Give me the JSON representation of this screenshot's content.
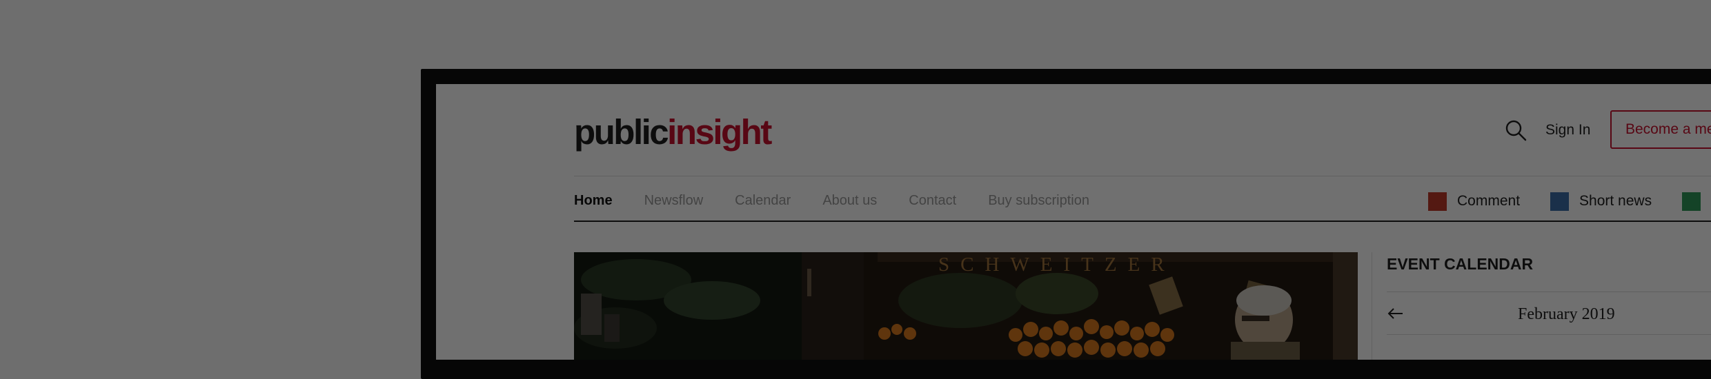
{
  "brand": {
    "logo_part1": "public",
    "logo_part2": "insight",
    "color_dark": "#1f1f1f",
    "color_accent": "#c8102e"
  },
  "header": {
    "search_icon": "search-icon",
    "sign_in_label": "Sign In",
    "become_member_label": "Become a me"
  },
  "nav": {
    "items": [
      {
        "label": "Home",
        "active": true
      },
      {
        "label": "Newsflow",
        "active": false
      },
      {
        "label": "Calendar",
        "active": false
      },
      {
        "label": "About us",
        "active": false
      },
      {
        "label": "Contact",
        "active": false
      },
      {
        "label": "Buy subscription",
        "active": false
      }
    ]
  },
  "legend": {
    "items": [
      {
        "label": "Comment",
        "color": "#c0392b"
      },
      {
        "label": "Short news",
        "color": "#3d6ea8"
      },
      {
        "label": "",
        "color": "#2e9a5a"
      }
    ]
  },
  "hero": {
    "shop_sign": "SCHWEITZER"
  },
  "event_calendar": {
    "title": "EVENT CALENDAR",
    "prev_icon": "arrow-left-icon",
    "month": "February 2019"
  }
}
